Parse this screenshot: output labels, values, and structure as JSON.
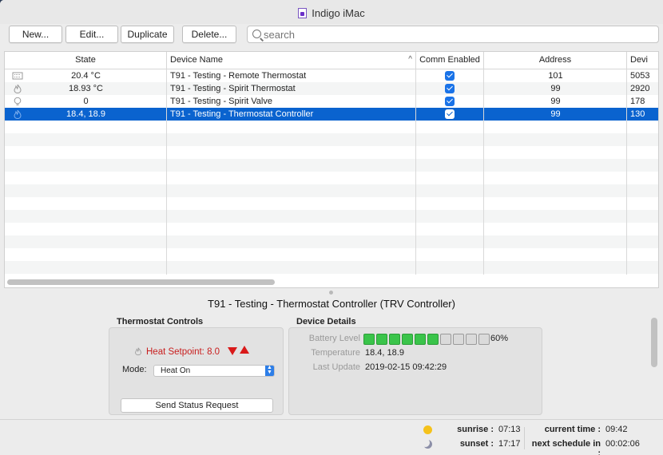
{
  "window": {
    "title": "Indigo iMac"
  },
  "toolbar": {
    "new_label": "New...",
    "edit_label": "Edit...",
    "duplicate_label": "Duplicate",
    "delete_label": "Delete...",
    "search_placeholder": "search"
  },
  "table": {
    "columns": [
      "State",
      "Device Name",
      "Comm Enabled",
      "Address",
      "Devi"
    ],
    "sort_indicator": "^",
    "rows": [
      {
        "icon": "thermostat-icon",
        "state": "20.4 °C",
        "name": "T91 - Testing - Remote Thermostat",
        "comm_enabled": true,
        "address": "101",
        "dev": "5053"
      },
      {
        "icon": "flame-icon",
        "state": "18.93 °C",
        "name": "T91 - Testing - Spirit Thermostat",
        "comm_enabled": true,
        "address": "99",
        "dev": "2920"
      },
      {
        "icon": "bulb-icon",
        "state": "0",
        "name": "T91 - Testing - Spirit Valve",
        "comm_enabled": true,
        "address": "99",
        "dev": "178"
      },
      {
        "icon": "flame-icon",
        "state": "18.4, 18.9",
        "name": "T91 - Testing - Thermostat Controller",
        "comm_enabled": true,
        "address": "99",
        "dev": "130",
        "selected": true
      }
    ]
  },
  "detail": {
    "title": "T91 - Testing - Thermostat Controller (TRV Controller)",
    "thermostat_controls": {
      "heading": "Thermostat Controls",
      "heat_setpoint": "Heat Setpoint: 8.0",
      "mode_label": "Mode:",
      "mode_value": "Heat On",
      "send_button": "Send Status Request"
    },
    "device_details": {
      "heading": "Device Details",
      "battery_label": "Battery Level",
      "battery_percent": "60%",
      "battery_level": 0.6,
      "temperature_label": "Temperature",
      "temperature_value": "18.4, 18.9",
      "last_update_label": "Last Update",
      "last_update_value": "2019-02-15 09:42:29"
    }
  },
  "status": {
    "sunrise_label": "sunrise :",
    "sunrise_value": "07:13",
    "sunset_label": "sunset :",
    "sunset_value": "17:17",
    "current_time_label": "current time :",
    "current_time_value": "09:42",
    "next_schedule_label": "next schedule in :",
    "next_schedule_value": "00:02:06"
  },
  "colors": {
    "selection": "#0a63cf",
    "setpoint_red": "#c81e1e",
    "battery_green": "#3ac44a"
  }
}
